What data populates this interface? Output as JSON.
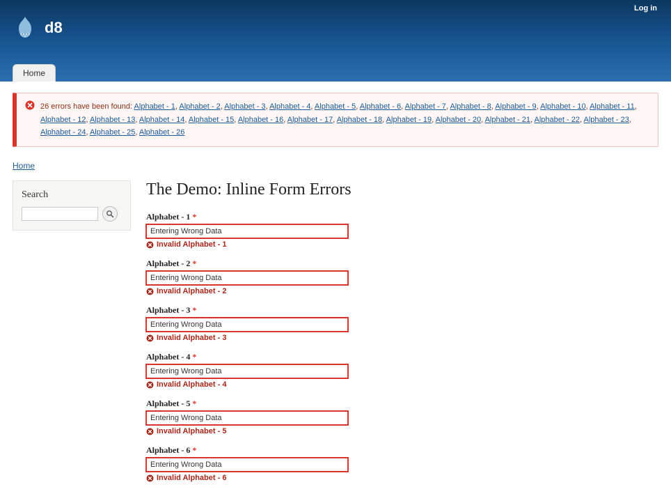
{
  "header": {
    "login": "Log in",
    "site_name": "d8",
    "home_tab": "Home"
  },
  "error_summary": {
    "intro": "26 errors have been found:",
    "links": [
      "Alphabet - 1",
      "Alphabet - 2",
      "Alphabet - 3",
      "Alphabet - 4",
      "Alphabet - 5",
      "Alphabet - 6",
      "Alphabet - 7",
      "Alphabet - 8",
      "Alphabet - 9",
      "Alphabet - 10",
      "Alphabet - 11",
      "Alphabet - 12",
      "Alphabet - 13",
      "Alphabet - 14",
      "Alphabet - 15",
      "Alphabet - 16",
      "Alphabet - 17",
      "Alphabet - 18",
      "Alphabet - 19",
      "Alphabet - 20",
      "Alphabet - 21",
      "Alphabet - 22",
      "Alphabet - 23",
      "Alphabet - 24",
      "Alphabet - 25",
      "Alphabet - 26"
    ]
  },
  "breadcrumb": {
    "home": "Home"
  },
  "sidebar": {
    "search_label": "Search"
  },
  "page_title": "The Demo: Inline Form Errors",
  "required_marker": "*",
  "fields": [
    {
      "label": "Alphabet - 1",
      "value": "Entering Wrong Data",
      "error": "Invalid Alphabet - 1"
    },
    {
      "label": "Alphabet - 2",
      "value": "Entering Wrong Data",
      "error": "Invalid Alphabet - 2"
    },
    {
      "label": "Alphabet - 3",
      "value": "Entering Wrong Data",
      "error": "Invalid Alphabet - 3"
    },
    {
      "label": "Alphabet - 4",
      "value": "Entering Wrong Data",
      "error": "Invalid Alphabet - 4"
    },
    {
      "label": "Alphabet - 5",
      "value": "Entering Wrong Data",
      "error": "Invalid Alphabet - 5"
    },
    {
      "label": "Alphabet - 6",
      "value": "Entering Wrong Data",
      "error": "Invalid Alphabet - 6"
    }
  ]
}
